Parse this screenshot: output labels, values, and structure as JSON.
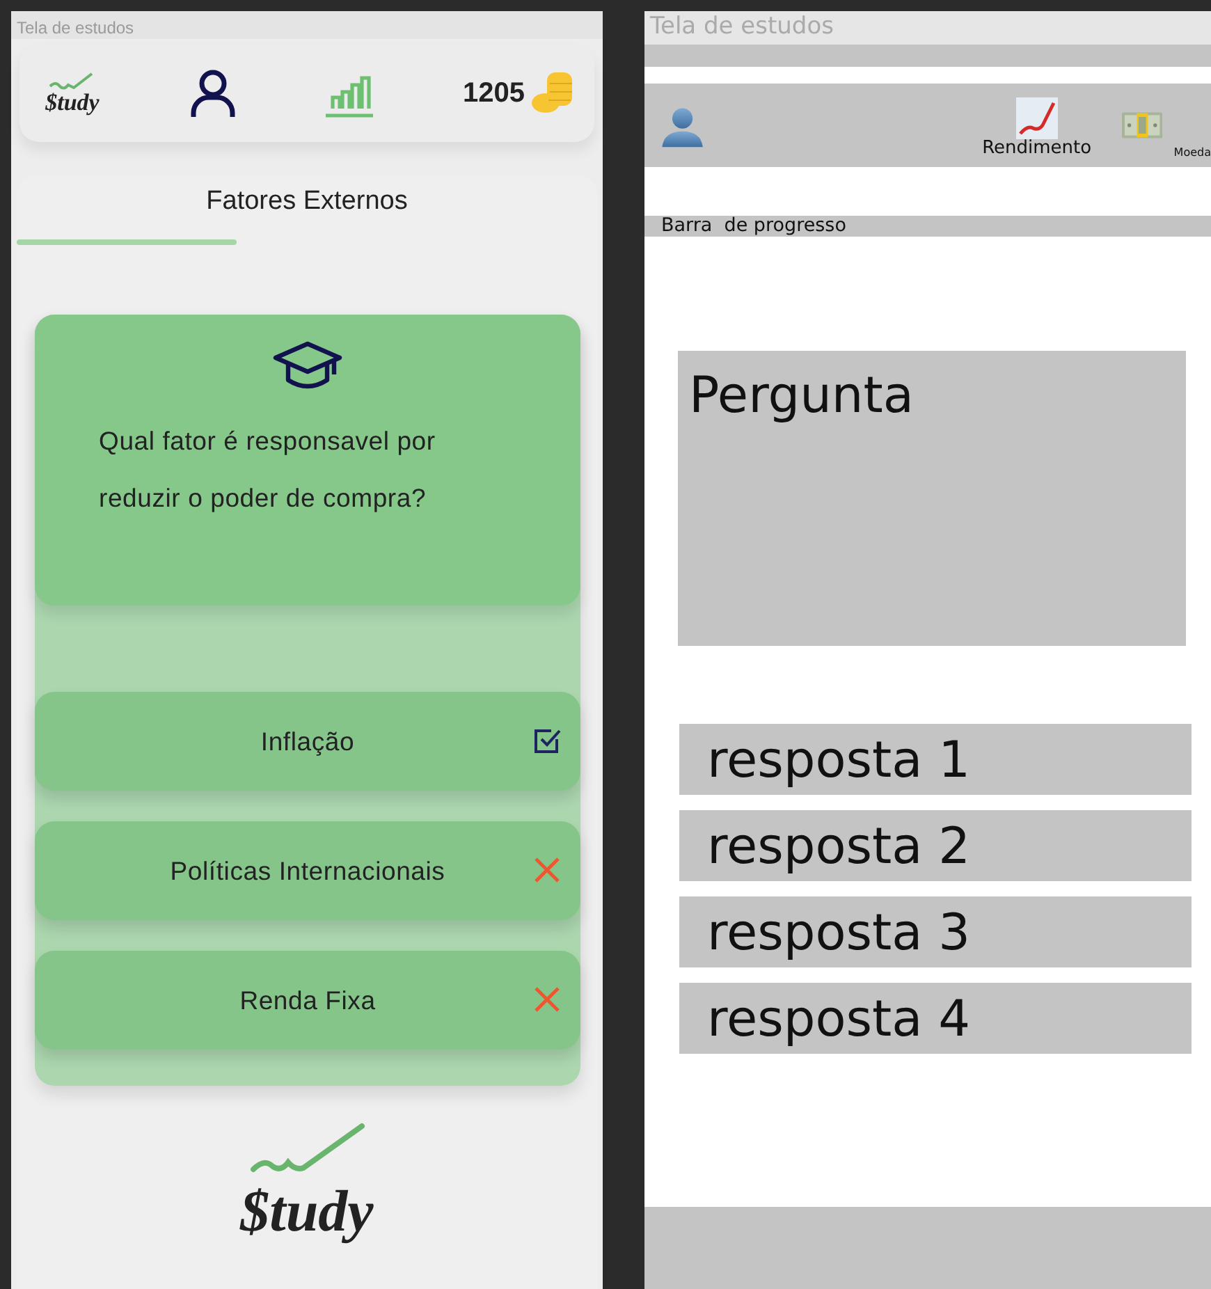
{
  "app_screen": {
    "title": "Tela de estudos",
    "header": {
      "logo": "$tudy",
      "coins": "1205"
    },
    "section": {
      "title": "Fatores Externos"
    },
    "question": "Qual fator é responsavel por reduzir o poder de compra?",
    "answers": [
      {
        "label": "Inflação",
        "correct": true
      },
      {
        "label": "Políticas Internacionais",
        "correct": false
      },
      {
        "label": "Renda Fixa",
        "correct": false
      }
    ],
    "footer_logo": "$tudy"
  },
  "wireframe": {
    "title": "Tela de estudos",
    "header_items": [
      {
        "kind": "profile"
      },
      {
        "kind": "chart",
        "label": "Rendimento"
      },
      {
        "kind": "money",
        "label": "Moeda"
      }
    ],
    "progress_label": "Barra  de progresso",
    "question": "Pergunta",
    "answers": [
      "resposta 1",
      "resposta 2",
      "resposta 3",
      "resposta 4"
    ]
  }
}
